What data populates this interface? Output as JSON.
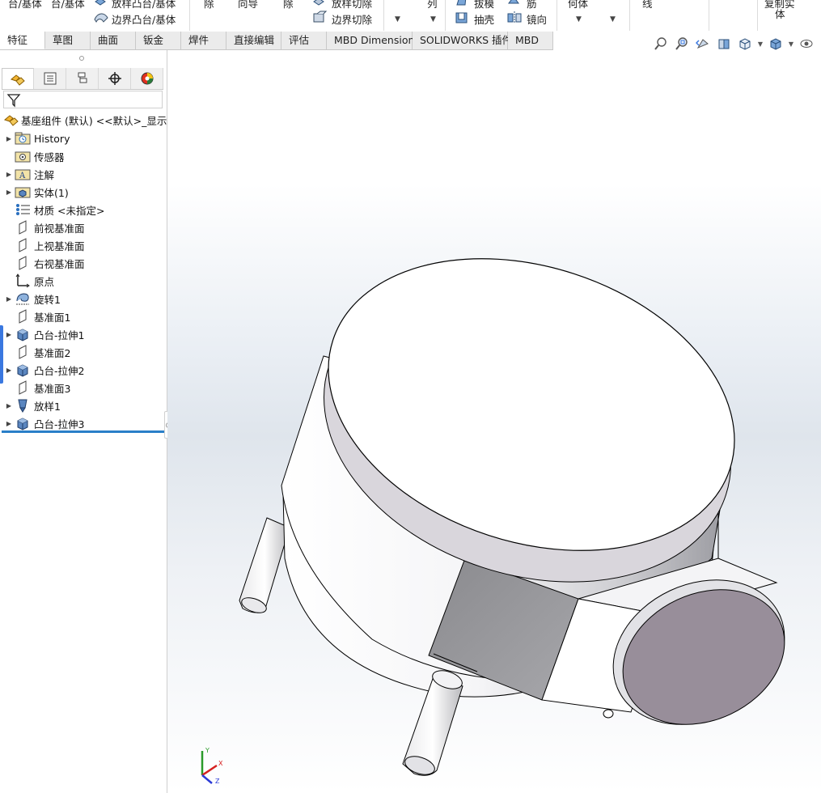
{
  "ribbon": {
    "fragments": [
      "台/基体",
      "台/基体",
      "放样凸台/基体",
      "除",
      "向导",
      "除",
      "放样切除",
      "列",
      "拔模",
      "筋",
      "何体",
      "线",
      "复制实",
      "体"
    ],
    "boundary_boss_label": "边界凸台/基体",
    "boundary_cut_label": "边界切除",
    "shell_label": "抽壳",
    "mirror_label": "镜向"
  },
  "tabs": [
    "特征",
    "草图",
    "曲面",
    "钣金",
    "焊件",
    "直接编辑",
    "评估",
    "MBD Dimensions",
    "SOLIDWORKS 插件",
    "MBD"
  ],
  "active_tab": "特征",
  "feature_tree": {
    "root": "基座组件 (默认) <<默认>_显示状",
    "items": [
      {
        "label": "History",
        "icon": "history-folder-icon",
        "expandable": true
      },
      {
        "label": "传感器",
        "icon": "sensor-folder-icon",
        "expandable": false
      },
      {
        "label": "注解",
        "icon": "annotations-folder-icon",
        "expandable": true
      },
      {
        "label": "实体(1)",
        "icon": "solid-bodies-folder-icon",
        "expandable": true
      },
      {
        "label": "材质 <未指定>",
        "icon": "material-icon",
        "expandable": false
      },
      {
        "label": "前视基准面",
        "icon": "plane-icon",
        "expandable": false
      },
      {
        "label": "上视基准面",
        "icon": "plane-icon",
        "expandable": false
      },
      {
        "label": "右视基准面",
        "icon": "plane-icon",
        "expandable": false
      },
      {
        "label": "原点",
        "icon": "origin-icon",
        "expandable": false
      },
      {
        "label": "旋转1",
        "icon": "revolve-icon",
        "expandable": true
      },
      {
        "label": "基准面1",
        "icon": "plane-icon",
        "expandable": false
      },
      {
        "label": "凸台-拉伸1",
        "icon": "extrude-icon",
        "expandable": true
      },
      {
        "label": "基准面2",
        "icon": "plane-icon",
        "expandable": false
      },
      {
        "label": "凸台-拉伸2",
        "icon": "extrude-icon",
        "expandable": true
      },
      {
        "label": "基准面3",
        "icon": "plane-icon",
        "expandable": false
      },
      {
        "label": "放样1",
        "icon": "loft-icon",
        "expandable": true
      },
      {
        "label": "凸台-拉伸3",
        "icon": "extrude-icon",
        "expandable": true
      }
    ]
  },
  "triad": {
    "x": "X",
    "y": "Y",
    "z": "Z"
  },
  "colors": {
    "accent": "#2a7fc8",
    "part_face": "#ffffff",
    "cap_face": "#9a8f9a",
    "edge": "#000000"
  }
}
